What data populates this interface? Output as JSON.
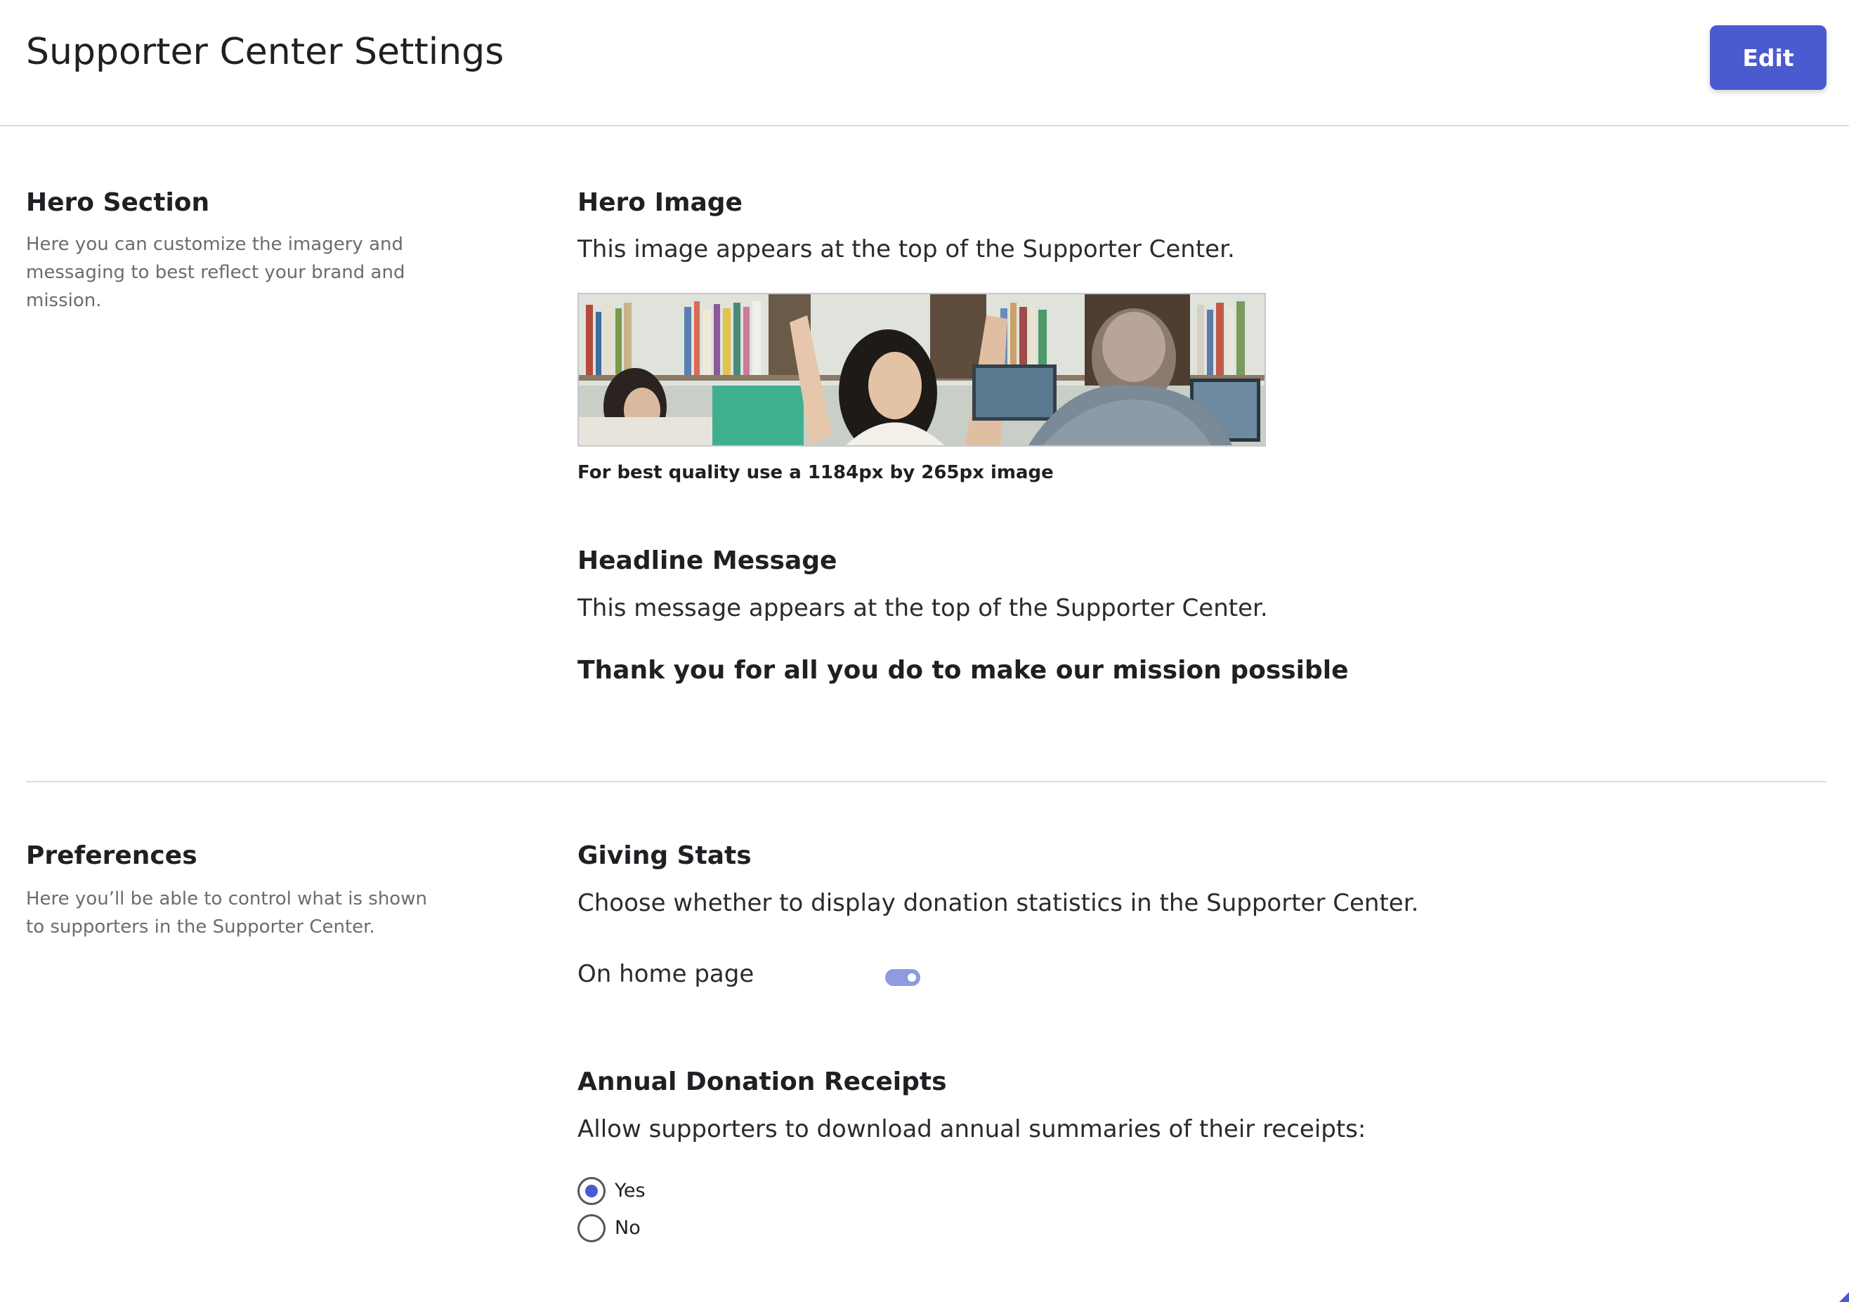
{
  "header": {
    "title": "Supporter Center Settings",
    "edit_label": "Edit"
  },
  "hero_section": {
    "title": "Hero Section",
    "description": "Here you can customize the imagery and messaging to best reflect your brand and mission.",
    "hero_image": {
      "title": "Hero Image",
      "description": "This image appears at the top of the Supporter Center.",
      "hint": "For best quality use a 1184px by 265px image"
    },
    "headline": {
      "title": "Headline Message",
      "description": "This message appears at the top of the Supporter Center.",
      "value": "Thank you for all you do to make our mission possible"
    }
  },
  "preferences": {
    "title": "Preferences",
    "description": "Here you’ll be able to control what is shown to supporters in the Supporter Center.",
    "giving_stats": {
      "title": "Giving Stats",
      "description": "Choose whether to display donation statistics in the Supporter Center.",
      "toggle_label": "On home page",
      "toggle_on": true
    },
    "annual_receipts": {
      "title": "Annual Donation Receipts",
      "description": "Allow supporters to download annual summaries of their receipts:",
      "options": [
        {
          "label": "Yes",
          "selected": true
        },
        {
          "label": "No",
          "selected": false
        }
      ]
    }
  },
  "colors": {
    "accent": "#4a5bcf",
    "toggle_track": "#8f9ae0",
    "divider": "#dcdce0"
  }
}
